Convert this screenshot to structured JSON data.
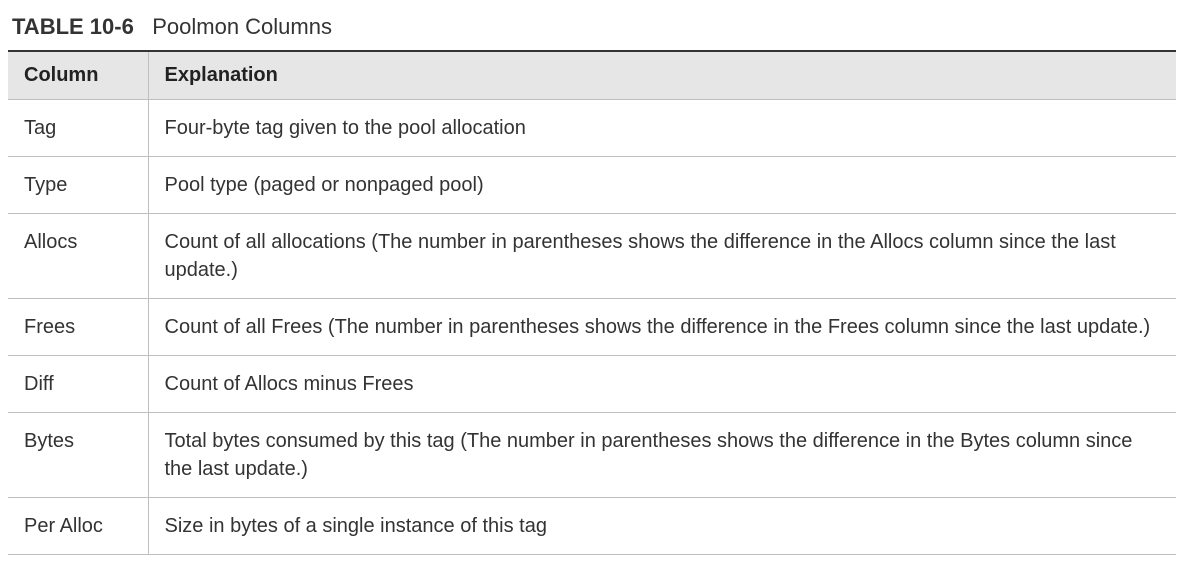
{
  "caption": {
    "label": "TABLE 10-6",
    "title": "Poolmon Columns"
  },
  "headers": {
    "col1": "Column",
    "col2": "Explanation"
  },
  "rows": [
    {
      "col": "Tag",
      "exp": "Four-byte tag given to the pool allocation"
    },
    {
      "col": "Type",
      "exp": "Pool type (paged or nonpaged pool)"
    },
    {
      "col": "Allocs",
      "exp": "Count of all allocations (The number in parentheses shows the difference in the Allocs column since the last update.)"
    },
    {
      "col": "Frees",
      "exp": "Count of all Frees (The number in parentheses shows the difference in the Frees column since the last update.)"
    },
    {
      "col": "Diff",
      "exp": "Count of Allocs minus Frees"
    },
    {
      "col": "Bytes",
      "exp": "Total bytes consumed by this tag (The number in parentheses shows the difference in the Bytes column since the last update.)"
    },
    {
      "col": "Per Alloc",
      "exp": "Size in bytes of a single instance of this tag"
    }
  ]
}
